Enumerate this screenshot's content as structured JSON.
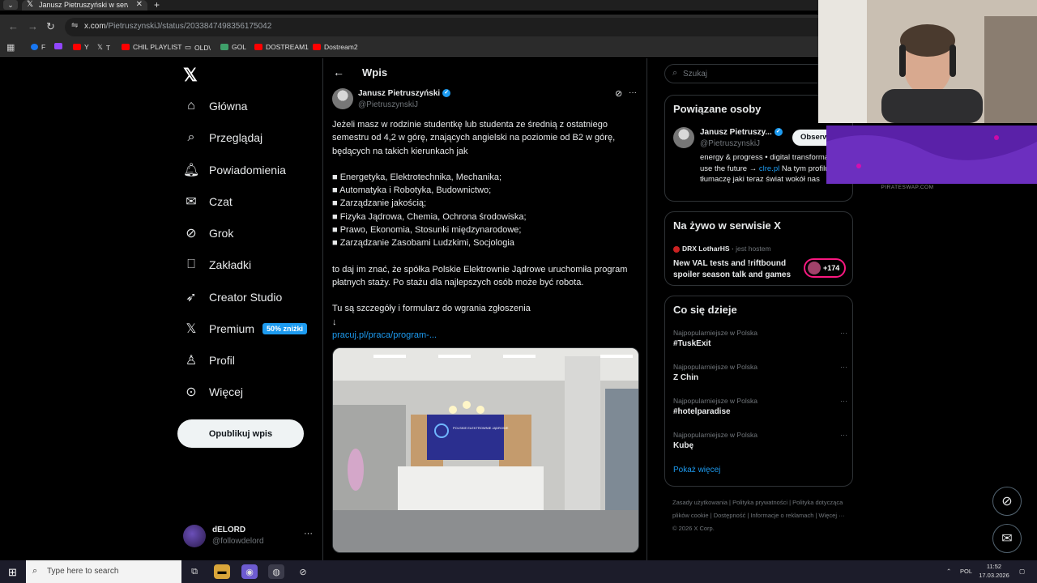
{
  "browser": {
    "tab_title": "Janusz Pietruszyński w serwisie X",
    "url_domain": "x.com",
    "url_path": "/PietruszynskiJ/status/2033847498356175042",
    "bookmarks": [
      "F",
      "",
      "Y",
      "T",
      "CHIL PLAYLIST",
      "OLD\\",
      "GOL",
      "DOSTREAM1",
      "Dostream2"
    ]
  },
  "nav": {
    "logo": "𝕏",
    "items": [
      "Główna",
      "Przeglądaj",
      "Powiadomienia",
      "Czat",
      "Grok",
      "Zakładki",
      "Creator Studio",
      "Premium",
      "Profil",
      "Więcej"
    ],
    "premium_badge": "50% zniżki",
    "post_button": "Opublikuj wpis",
    "account_name": "dELORD",
    "account_handle": "@followdelord",
    "account_more": "···"
  },
  "main": {
    "header_title": "Wpis",
    "author_name": "Janusz Pietruszyński",
    "author_handle": "@PietruszynskiJ",
    "intro": "Jeżeli masz w rodzinie studentkę lub studenta ze średnią z ostatniego semestru od 4,2 w górę, znających angielski na poziomie od B2 w górę, będących na takich kierunkach jak",
    "fields": [
      "■ Energetyka, Elektrotechnika, Mechanika;",
      "■ Automatyka i Robotyka, Budownictwo;",
      "■ Zarządzanie jakością;",
      "■ Fizyka Jądrowa, Chemia, Ochrona środowiska;",
      "■ Prawo, Ekonomia, Stosunki międzynarodowe;",
      "■ Zarządzanie Zasobami Ludzkimi, Socjologia"
    ],
    "outro": "to daj im znać, że spółka Polskie Elektrownie Jądrowe uruchomiła program płatnych staży. Po stażu dla najlepszych osób może być robota.",
    "details": "Tu są szczegóły i formularz do wgrania zgłoszenia",
    "arrow": "↓",
    "link": "pracuj.pl/praca/program-...",
    "image_sign": "POLSKIE ELEKTROWNIE JĄDROWE"
  },
  "right": {
    "search_placeholder": "Szukaj",
    "related_title": "Powiązane osoby",
    "related_name": "Janusz Pietruszy...",
    "related_handle": "@PietruszynskiJ",
    "follow_label": "Obserwuj",
    "related_bio_1": "energy & progress • digital transformation • use the future → ",
    "related_bio_link": "clre.pl",
    "related_bio_2": " Na tym profilu tłumaczę jaki teraz świat wokół nas",
    "live_title_header": "Na żywo w serwisie X",
    "live_host": "DRX LotharHS",
    "live_host_suffix": "jest hostem",
    "live_title": "New VAL tests and !riftbound spoiler season talk and games",
    "live_count": "+174",
    "trends_title": "Co się dzieje",
    "trends": [
      {
        "category": "Najpopularniejsze w Polska",
        "name": "#TuskExit"
      },
      {
        "category": "Najpopularniejsze w Polska",
        "name": "Z Chin"
      },
      {
        "category": "Najpopularniejsze w Polska",
        "name": "#hotelparadise"
      },
      {
        "category": "Najpopularniejsze w Polska",
        "name": "Kubę"
      }
    ],
    "show_more": "Pokaż więcej",
    "footer": "Zasady użytkowania | Polityka prywatności | Polityka dotycząca plików cookie | Dostępność | Informacje o reklamach | Więcej ··· © 2026 X Corp."
  },
  "overlay": {
    "promo_caption": "PIRATESWAP.COM"
  },
  "taskbar": {
    "search_placeholder": "Type here to search",
    "language": "POL",
    "time": "11:52",
    "date": "17.03.2026"
  }
}
